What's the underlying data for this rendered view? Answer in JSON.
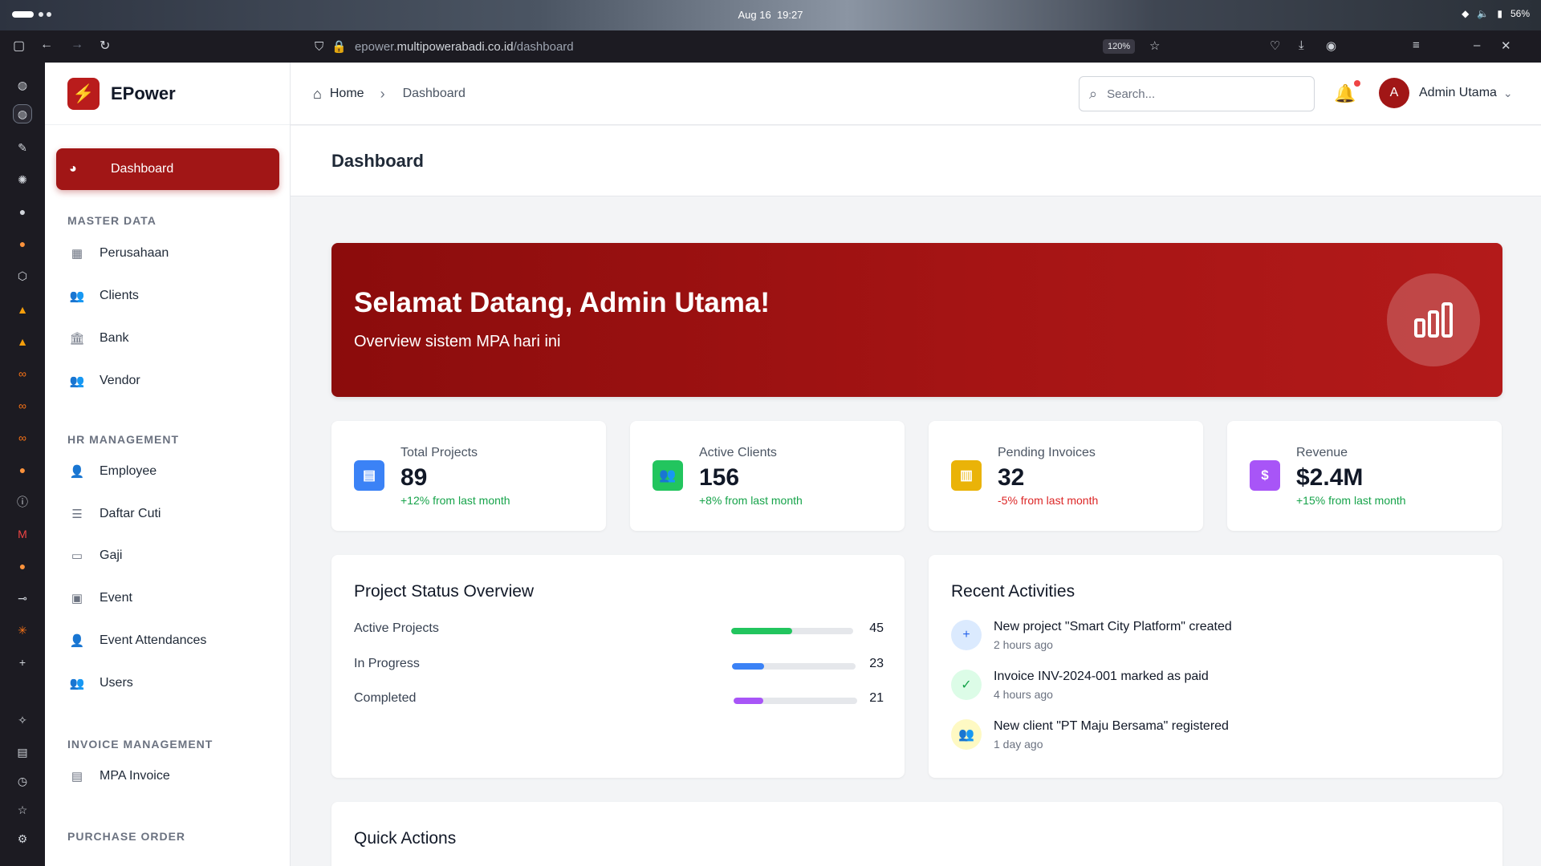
{
  "os": {
    "date": "Aug 16",
    "time": "19:27",
    "battery": "56%"
  },
  "browser": {
    "url_prefix": "epower.",
    "url_domain": "multipowerabadi.co.id",
    "url_path": "/dashboard",
    "zoom": "120%"
  },
  "brand": {
    "name": "EPower",
    "logo_glyph": "⚡"
  },
  "sidebar": {
    "active_item": "Dashboard",
    "sections": [
      {
        "title": "MASTER DATA",
        "items": [
          "Perusahaan",
          "Clients",
          "Bank",
          "Vendor"
        ]
      },
      {
        "title": "HR MANAGEMENT",
        "items": [
          "Employee",
          "Daftar Cuti",
          "Gaji",
          "Event",
          "Event Attendances",
          "Users"
        ]
      },
      {
        "title": "INVOICE MANAGEMENT",
        "items": [
          "MPA Invoice"
        ]
      },
      {
        "title": "PURCHASE ORDER",
        "items": []
      }
    ]
  },
  "header": {
    "breadcrumb_home": "Home",
    "breadcrumb_current": "Dashboard",
    "search_placeholder": "Search...",
    "user_initial": "A",
    "user_name": "Admin Utama"
  },
  "page_title": "Dashboard",
  "hero": {
    "title": "Selamat Datang, Admin Utama!",
    "subtitle": "Overview sistem MPA hari ini"
  },
  "stats": [
    {
      "label": "Total Projects",
      "value": "89",
      "change": "+12% from last month",
      "trend": "up",
      "color": "#3b82f6",
      "icon": "clipboard-icon"
    },
    {
      "label": "Active Clients",
      "value": "156",
      "change": "+8% from last month",
      "trend": "up",
      "color": "#22c55e",
      "icon": "users-icon"
    },
    {
      "label": "Pending Invoices",
      "value": "32",
      "change": "-5% from last month",
      "trend": "down",
      "color": "#eab308",
      "icon": "file-icon"
    },
    {
      "label": "Revenue",
      "value": "$2.4M",
      "change": "+15% from last month",
      "trend": "up",
      "color": "#a855f7",
      "icon": "dollar-icon"
    }
  ],
  "project_status": {
    "title": "Project Status Overview",
    "rows": [
      {
        "label": "Active Projects",
        "value": "45",
        "fraction": 0.5,
        "color": "#22c55e"
      },
      {
        "label": "In Progress",
        "value": "23",
        "fraction": 0.26,
        "color": "#3b82f6"
      },
      {
        "label": "Completed",
        "value": "21",
        "fraction": 0.24,
        "color": "#a855f7"
      }
    ]
  },
  "recent_activities": {
    "title": "Recent Activities",
    "items": [
      {
        "text": "New project \"Smart City Platform\" created",
        "time": "2 hours ago",
        "icon": "plus-icon",
        "bg": "#dbeafe",
        "fg": "#2563eb"
      },
      {
        "text": "Invoice INV-2024-001 marked as paid",
        "time": "4 hours ago",
        "icon": "check-circle-icon",
        "bg": "#dcfce7",
        "fg": "#16a34a"
      },
      {
        "text": "New client \"PT Maju Bersama\" registered",
        "time": "1 day ago",
        "icon": "users-icon",
        "bg": "#fef9c3",
        "fg": "#ca8a04"
      }
    ]
  },
  "quick_actions": {
    "title": "Quick Actions"
  }
}
